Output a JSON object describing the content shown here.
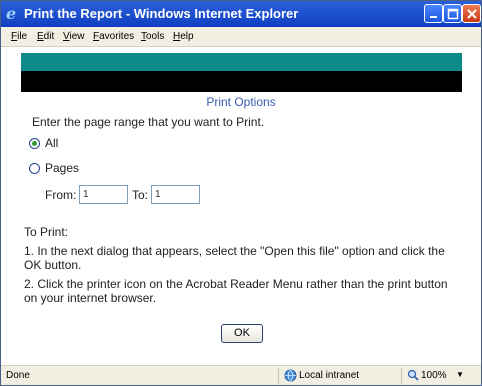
{
  "window": {
    "title": "Print the Report - Windows Internet Explorer",
    "icon": "ie-icon"
  },
  "menubar": {
    "items": [
      "File",
      "Edit",
      "View",
      "Favorites",
      "Tools",
      "Help"
    ]
  },
  "page": {
    "options_title": "Print Options",
    "instruction": "Enter the page range that you want to Print.",
    "radio_all_label": "All",
    "radio_pages_label": "Pages",
    "from_label": "From:",
    "from_value": "1",
    "to_label": "To:",
    "to_value": "1",
    "to_print_heading": "To Print:",
    "step1": "1. In the next dialog that appears, select the \"Open this file\" option and click the OK button.",
    "step2": "2. Click the printer icon on the Acrobat Reader Menu rather than the print button on your internet browser.",
    "ok_label": "OK",
    "selected_option": "All"
  },
  "statusbar": {
    "status": "Done",
    "zone": "Local intranet",
    "zoom": "100%"
  },
  "colors": {
    "teal_bar": "#0b8a8a",
    "title_link": "#3b5bb5",
    "titlebar": "#1e52d0"
  }
}
